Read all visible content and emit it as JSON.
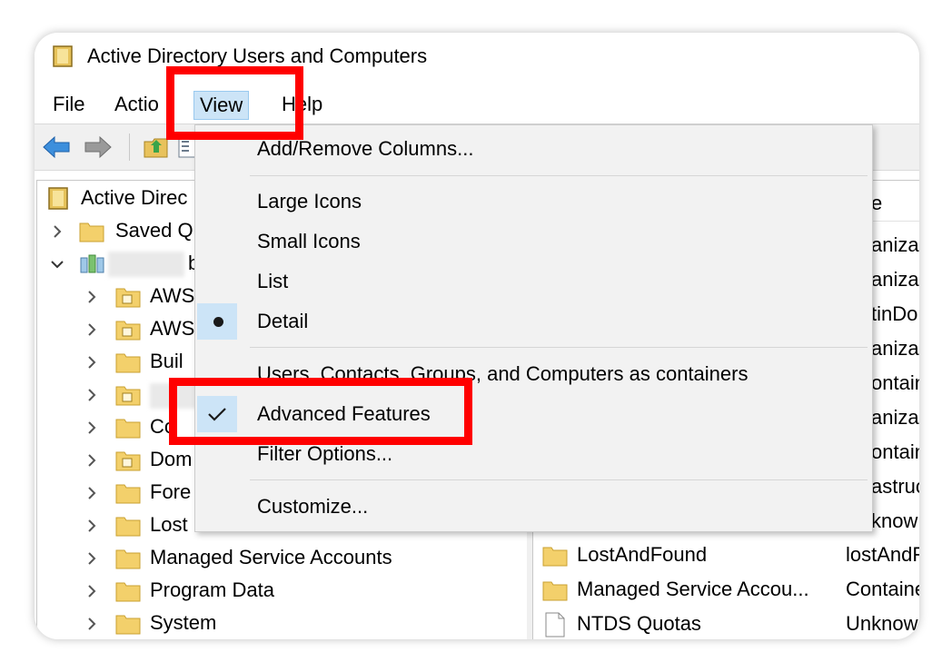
{
  "window": {
    "title": "Active Directory Users and Computers"
  },
  "menubar": {
    "file": "File",
    "action": "Actio",
    "view": "View",
    "help": "Help"
  },
  "view_menu": {
    "add_remove_columns": "Add/Remove Columns...",
    "large_icons": "Large Icons",
    "small_icons": "Small Icons",
    "list": "List",
    "detail": "Detail",
    "users_as_containers": "Users, Contacts, Groups, and Computers as containers",
    "advanced_features": "Advanced Features",
    "filter_options": "Filter Options...",
    "customize": "Customize..."
  },
  "tree": {
    "root": "Active Direc",
    "saved_queries": "Saved Q",
    "domain_letter": "b",
    "items": [
      "AWS",
      "AWS",
      "Buil",
      "",
      "Co",
      "Dom",
      "Fore",
      "Lost",
      "Managed Service Accounts",
      "Program Data",
      "System"
    ]
  },
  "list": {
    "header_type": "e",
    "type_fragments": [
      "aniza",
      "aniza",
      "tinDo",
      "aniza",
      "ontaine",
      "aniza",
      "ontaine",
      "astruc",
      "know"
    ],
    "rows": [
      {
        "name": "LostAndFound",
        "type": "lostAndF"
      },
      {
        "name": "Managed Service Accou...",
        "type": "Containe"
      },
      {
        "name": "NTDS Quotas",
        "type": "Unknow"
      }
    ]
  },
  "colors": {
    "highlight": "#ff0000",
    "selected_menu": "#cce4f7",
    "folder": "#e8c25c"
  }
}
